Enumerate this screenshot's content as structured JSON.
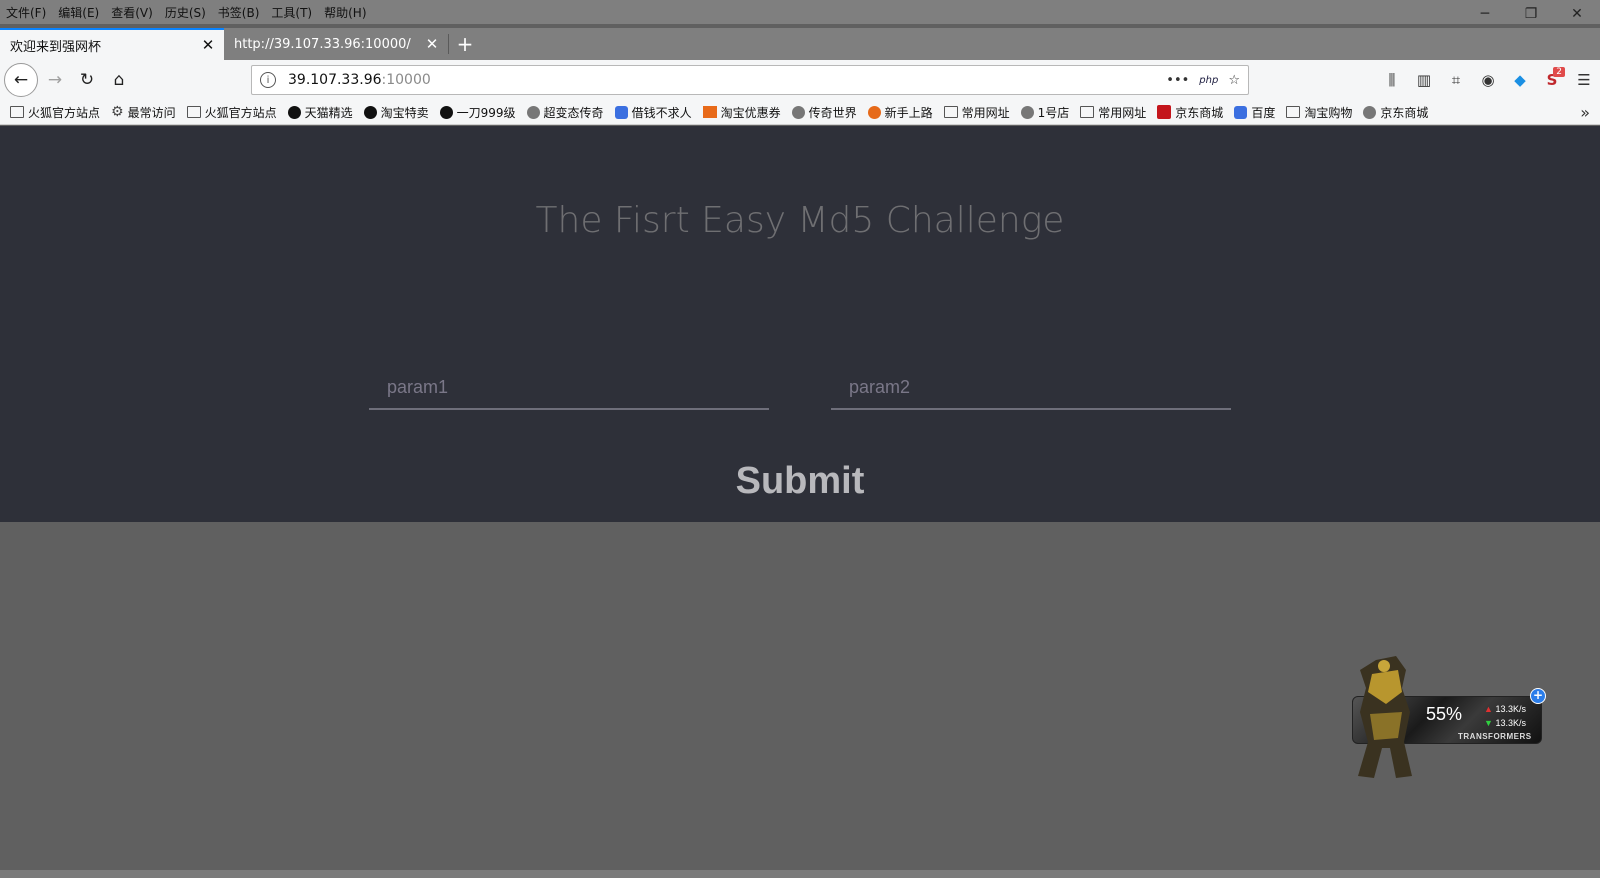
{
  "menubar": {
    "items": [
      "文件(F)",
      "编辑(E)",
      "查看(V)",
      "历史(S)",
      "书签(B)",
      "工具(T)",
      "帮助(H)"
    ]
  },
  "window_controls": {
    "minimize": "─",
    "restore": "❐",
    "close": "✕"
  },
  "tabs": [
    {
      "label": "欢迎来到强网杯",
      "active": true
    },
    {
      "label": "http://39.107.33.96:10000/",
      "active": false
    }
  ],
  "newtab_label": "+",
  "nav": {
    "back": "←",
    "forward": "→",
    "reload": "↻",
    "home": "⌂"
  },
  "url": {
    "host": "39.107.33.96",
    "port": ":10000",
    "more": "•••",
    "php": "php",
    "star": "☆"
  },
  "toolbar_right": {
    "library": "⫼",
    "sidebar": "▥",
    "crop": "⌗",
    "eye": "◉",
    "ext": "◆",
    "addon": "S",
    "addon_badge": "2",
    "menu": "☰"
  },
  "bookmarks": [
    {
      "label": "火狐官方站点",
      "icon": "folder"
    },
    {
      "label": "最常访问",
      "icon": "gear"
    },
    {
      "label": "火狐官方站点",
      "icon": "folder"
    },
    {
      "label": "天猫精选",
      "icon": "dark"
    },
    {
      "label": "淘宝特卖",
      "icon": "dark"
    },
    {
      "label": "一刀999级",
      "icon": "dark"
    },
    {
      "label": "超变态传奇",
      "icon": "globe"
    },
    {
      "label": "借钱不求人",
      "icon": "baidu"
    },
    {
      "label": "淘宝优惠券",
      "icon": "tb"
    },
    {
      "label": "传奇世界",
      "icon": "globe"
    },
    {
      "label": "新手上路",
      "icon": "fox"
    },
    {
      "label": "常用网址",
      "icon": "folder"
    },
    {
      "label": "1号店",
      "icon": "globe"
    },
    {
      "label": "常用网址",
      "icon": "folder"
    },
    {
      "label": "京东商城",
      "icon": "jd"
    },
    {
      "label": "百度",
      "icon": "baidu"
    },
    {
      "label": "淘宝购物",
      "icon": "folder"
    },
    {
      "label": "京东商城",
      "icon": "globe"
    }
  ],
  "bookmarks_more": "»",
  "page": {
    "title": "The Fisrt Easy Md5 Challenge",
    "param1_placeholder": "param1",
    "param2_placeholder": "param2",
    "submit_label": "Submit"
  },
  "netmon": {
    "percent": "55%",
    "up": "13.3K/s",
    "down": "13.3K/s",
    "brand": "TRANSFORMERS",
    "plus": "+"
  }
}
